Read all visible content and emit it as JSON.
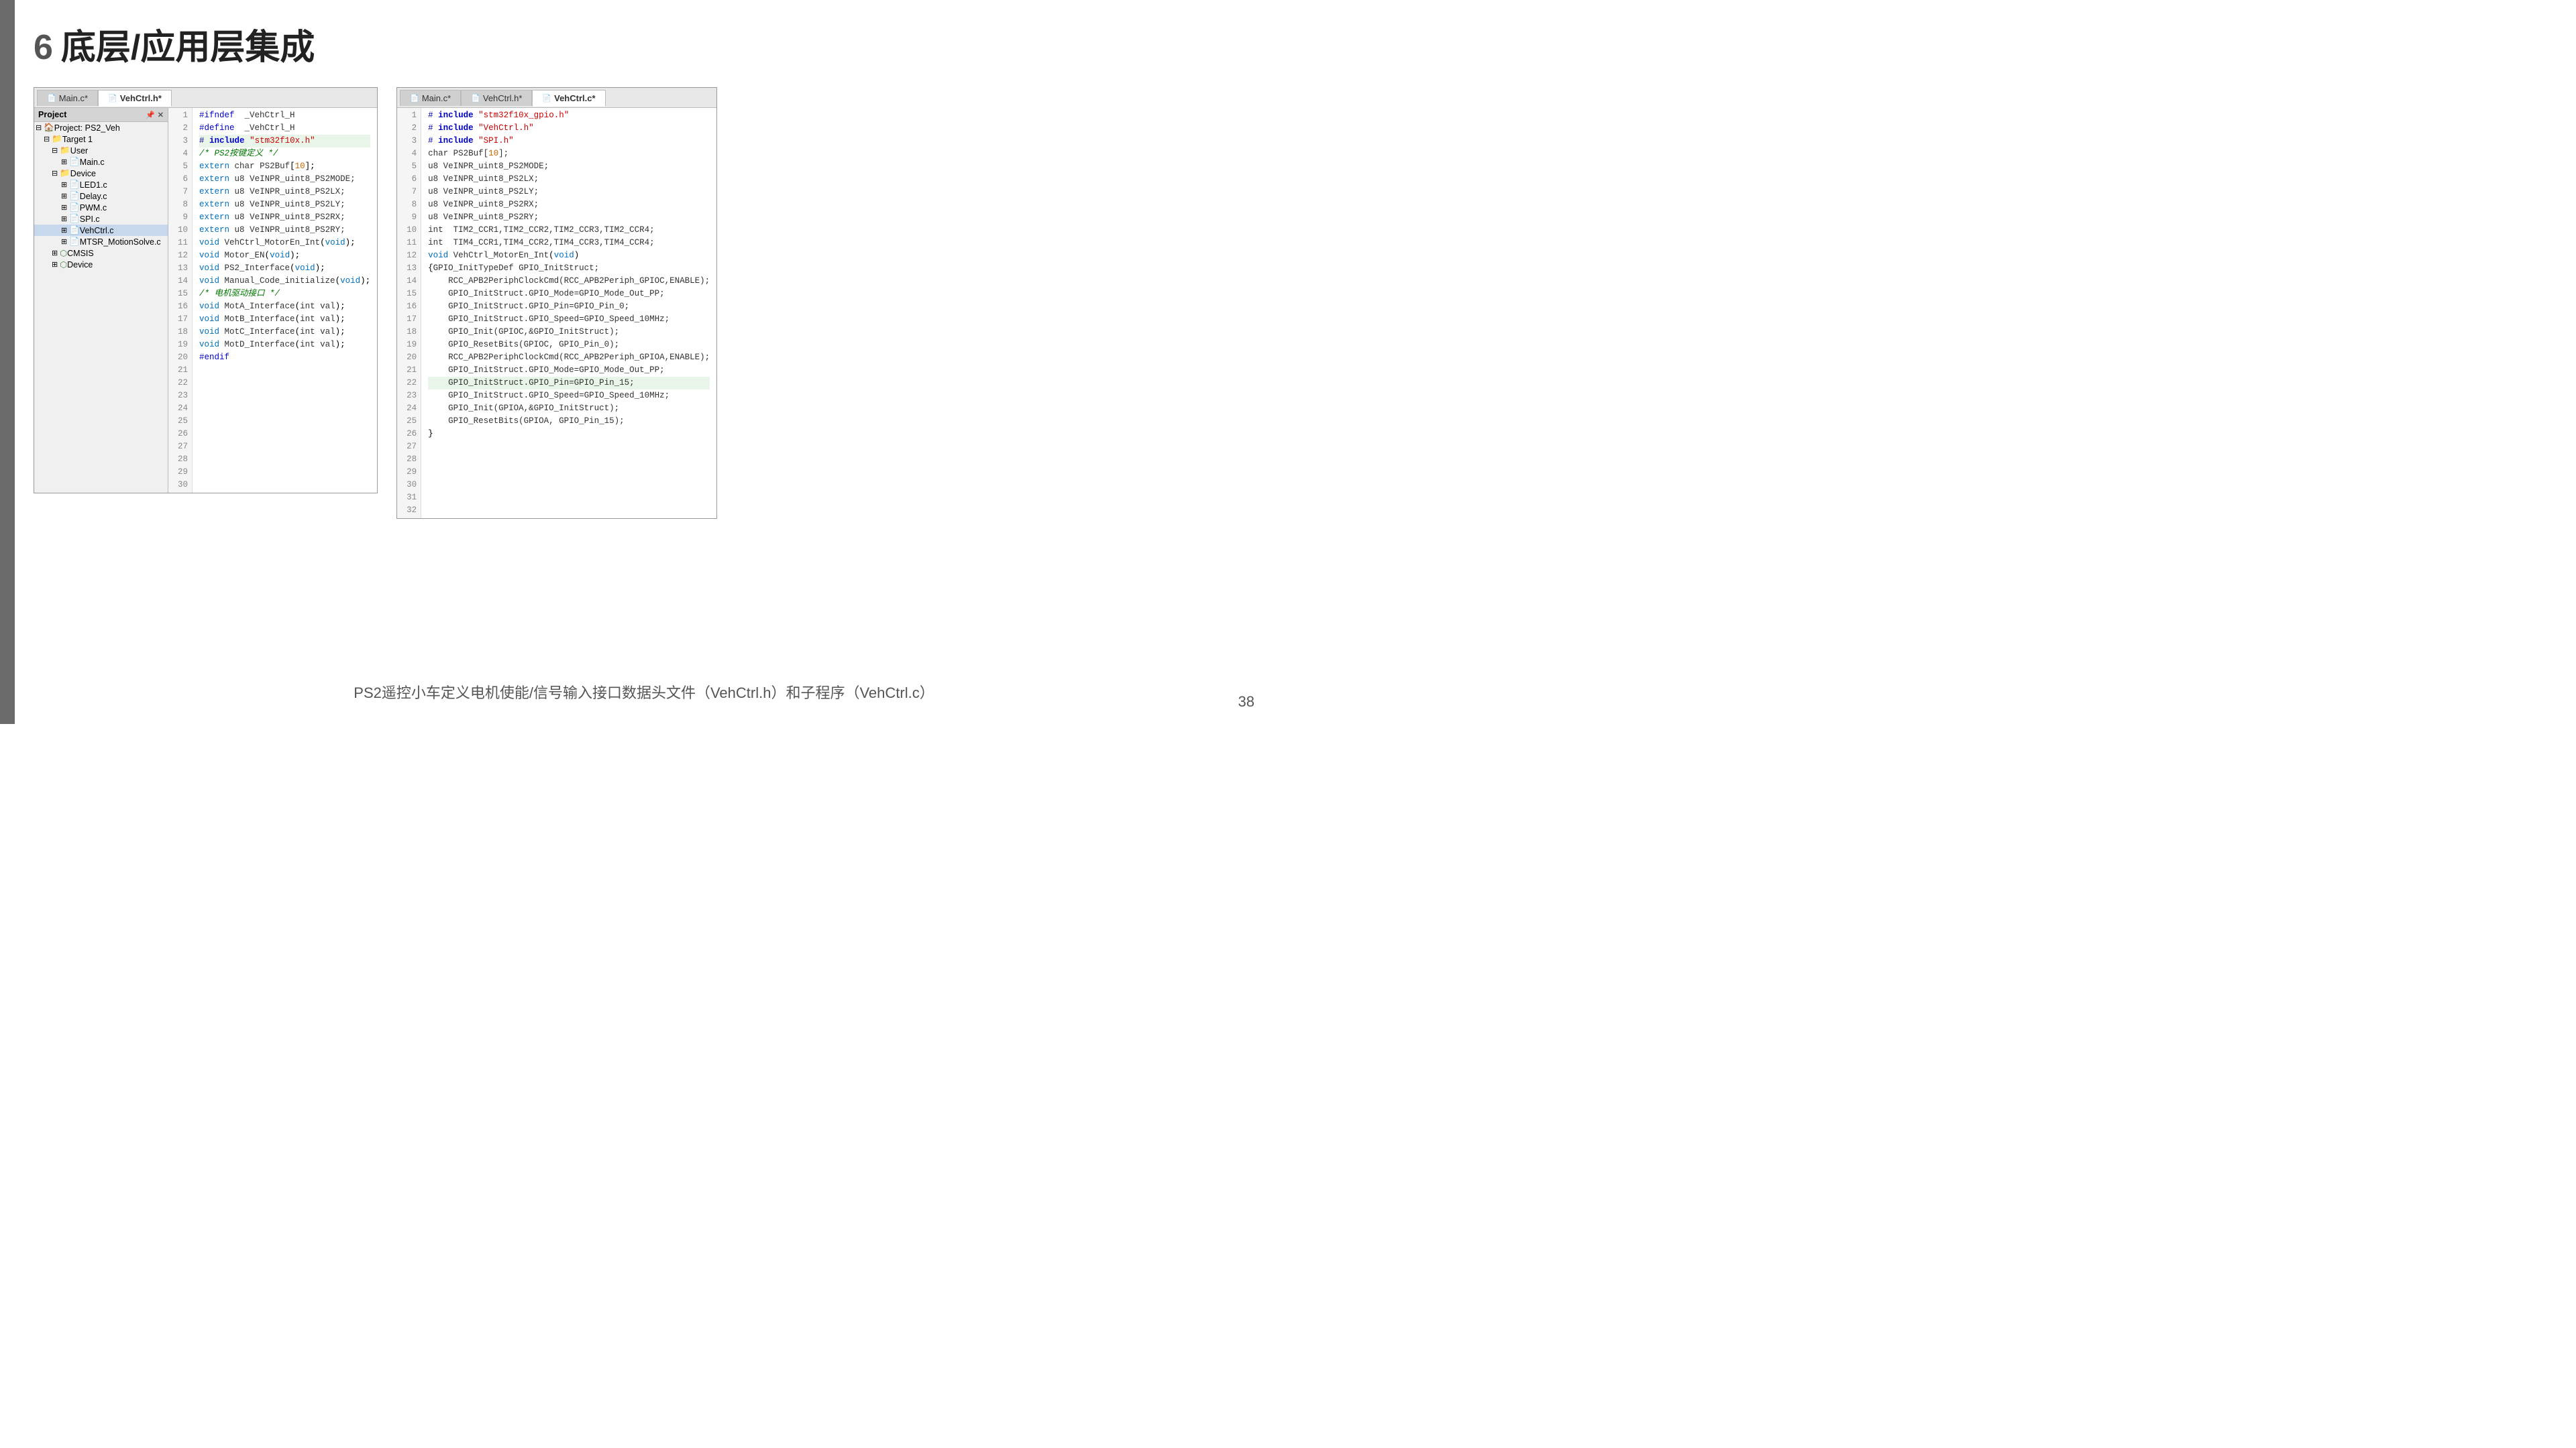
{
  "page": {
    "title_num": "6",
    "title_text": "底层/应用层集成",
    "page_number": "38",
    "caption": "PS2遥控小车定义电机使能/信号输入接口数据头文件（VehCtrl.h）和子程序（VehCtrl.c）"
  },
  "left_ide": {
    "tabs": [
      {
        "label": "Main.c*",
        "active": false,
        "icon": "file"
      },
      {
        "label": "VehCtrl.h*",
        "active": true,
        "icon": "file"
      }
    ],
    "project_tree_title": "Project",
    "tree_items": [
      {
        "indent": 0,
        "type": "tree",
        "label": "Project: PS2_Veh",
        "icon": "tree"
      },
      {
        "indent": 1,
        "type": "tree",
        "label": "Target 1",
        "icon": "tree"
      },
      {
        "indent": 2,
        "type": "folder",
        "label": "User",
        "icon": "folder"
      },
      {
        "indent": 3,
        "type": "file",
        "label": "Main.c",
        "icon": "file"
      },
      {
        "indent": 2,
        "type": "folder",
        "label": "Device",
        "icon": "folder"
      },
      {
        "indent": 3,
        "type": "file",
        "label": "LED1.c",
        "icon": "file"
      },
      {
        "indent": 3,
        "type": "file",
        "label": "Delay.c",
        "icon": "file"
      },
      {
        "indent": 3,
        "type": "file",
        "label": "PWM.c",
        "icon": "file"
      },
      {
        "indent": 3,
        "type": "file",
        "label": "SPI.c",
        "icon": "file"
      },
      {
        "indent": 3,
        "type": "file",
        "label": "VehCtrl.c",
        "icon": "file",
        "selected": true
      },
      {
        "indent": 3,
        "type": "file",
        "label": "MTSR_MotionSolve.c",
        "icon": "file"
      },
      {
        "indent": 2,
        "type": "gear",
        "label": "CMSIS",
        "icon": "gear"
      },
      {
        "indent": 2,
        "type": "gear",
        "label": "Device",
        "icon": "gear"
      }
    ],
    "code_lines": [
      {
        "n": 1,
        "text": "#ifndef  _VehCtrl_H",
        "hl": false
      },
      {
        "n": 2,
        "text": "#define  _VehCtrl_H",
        "hl": false
      },
      {
        "n": 3,
        "text": "",
        "hl": false
      },
      {
        "n": 4,
        "text": "# include \"stm32f10x.h\"",
        "hl": true
      },
      {
        "n": 5,
        "text": "",
        "hl": false
      },
      {
        "n": 6,
        "text": "/* PS2按键定义 */",
        "hl": false
      },
      {
        "n": 7,
        "text": "extern char PS2Buf[10];",
        "hl": false
      },
      {
        "n": 8,
        "text": "",
        "hl": false
      },
      {
        "n": 9,
        "text": "extern u8 VeINPR_uint8_PS2MODE;",
        "hl": false
      },
      {
        "n": 10,
        "text": "extern u8 VeINPR_uint8_PS2LX;",
        "hl": false
      },
      {
        "n": 11,
        "text": "extern u8 VeINPR_uint8_PS2LY;",
        "hl": false
      },
      {
        "n": 12,
        "text": "extern u8 VeINPR_uint8_PS2RX;",
        "hl": false
      },
      {
        "n": 13,
        "text": "extern u8 VeINPR_uint8_PS2RY;",
        "hl": false
      },
      {
        "n": 14,
        "text": "",
        "hl": false
      },
      {
        "n": 15,
        "text": "void VehCtrl_MotorEn_Int(void);",
        "hl": false
      },
      {
        "n": 16,
        "text": "void Motor_EN(void);",
        "hl": false
      },
      {
        "n": 17,
        "text": "",
        "hl": false
      },
      {
        "n": 18,
        "text": "void PS2_Interface(void);",
        "hl": false
      },
      {
        "n": 19,
        "text": "void Manual_Code_initialize(void);",
        "hl": false
      },
      {
        "n": 20,
        "text": "",
        "hl": false
      },
      {
        "n": 21,
        "text": "",
        "hl": false
      },
      {
        "n": 22,
        "text": "/* 电机驱动接口 */",
        "hl": false
      },
      {
        "n": 23,
        "text": "void MotA_Interface(int val);",
        "hl": false
      },
      {
        "n": 24,
        "text": "void MotB_Interface(int val);",
        "hl": false
      },
      {
        "n": 25,
        "text": "void MotC_Interface(int val);",
        "hl": false
      },
      {
        "n": 26,
        "text": "void MotD_Interface(int val);",
        "hl": false
      },
      {
        "n": 27,
        "text": "",
        "hl": false
      },
      {
        "n": 28,
        "text": "#endif",
        "hl": false
      },
      {
        "n": 29,
        "text": "",
        "hl": false
      },
      {
        "n": 30,
        "text": "",
        "hl": false
      }
    ]
  },
  "right_ide": {
    "tabs": [
      {
        "label": "Main.c*",
        "active": false,
        "icon": "file"
      },
      {
        "label": "VehCtrl.h*",
        "active": false,
        "icon": "file"
      },
      {
        "label": "VehCtrl.c*",
        "active": true,
        "icon": "file"
      }
    ],
    "code_lines": [
      {
        "n": 1,
        "text": "# include \"stm32f10x_gpio.h\"",
        "hl": false
      },
      {
        "n": 2,
        "text": "# include \"VehCtrl.h\"",
        "hl": false
      },
      {
        "n": 3,
        "text": "# include \"SPI.h\"",
        "hl": false
      },
      {
        "n": 4,
        "text": "",
        "hl": false
      },
      {
        "n": 5,
        "text": "char PS2Buf[10];",
        "hl": false
      },
      {
        "n": 6,
        "text": "",
        "hl": false
      },
      {
        "n": 7,
        "text": "u8 VeINPR_uint8_PS2MODE;",
        "hl": false
      },
      {
        "n": 8,
        "text": "u8 VeINPR_uint8_PS2LX;",
        "hl": false
      },
      {
        "n": 9,
        "text": "u8 VeINPR_uint8_PS2LY;",
        "hl": false
      },
      {
        "n": 10,
        "text": "u8 VeINPR_uint8_PS2RX;",
        "hl": false
      },
      {
        "n": 11,
        "text": "u8 VeINPR_uint8_PS2RY;",
        "hl": false
      },
      {
        "n": 12,
        "text": "",
        "hl": false
      },
      {
        "n": 13,
        "text": "int  TIM2_CCR1,TIM2_CCR2,TIM2_CCR3,TIM2_CCR4;",
        "hl": false
      },
      {
        "n": 14,
        "text": "int  TIM4_CCR1,TIM4_CCR2,TIM4_CCR3,TIM4_CCR4;",
        "hl": false
      },
      {
        "n": 15,
        "text": "",
        "hl": false
      },
      {
        "n": 16,
        "text": "void VehCtrl_MotorEn_Int(void)",
        "hl": false
      },
      {
        "n": 17,
        "text": "{GPIO_InitTypeDef GPIO_InitStruct;",
        "hl": false
      },
      {
        "n": 18,
        "text": "",
        "hl": false
      },
      {
        "n": 19,
        "text": "    RCC_APB2PeriphClockCmd(RCC_APB2Periph_GPIOC,ENABLE);",
        "hl": false
      },
      {
        "n": 20,
        "text": "    GPIO_InitStruct.GPIO_Mode=GPIO_Mode_Out_PP;",
        "hl": false
      },
      {
        "n": 21,
        "text": "    GPIO_InitStruct.GPIO_Pin=GPIO_Pin_0;",
        "hl": false
      },
      {
        "n": 22,
        "text": "    GPIO_InitStruct.GPIO_Speed=GPIO_Speed_10MHz;",
        "hl": false
      },
      {
        "n": 23,
        "text": "    GPIO_Init(GPIOC,&GPIO_InitStruct);",
        "hl": false
      },
      {
        "n": 24,
        "text": "    GPIO_ResetBits(GPIOC, GPIO_Pin_0);",
        "hl": false
      },
      {
        "n": 25,
        "text": "",
        "hl": false
      },
      {
        "n": 26,
        "text": "    RCC_APB2PeriphClockCmd(RCC_APB2Periph_GPIOA,ENABLE);",
        "hl": false
      },
      {
        "n": 27,
        "text": "    GPIO_InitStruct.GPIO_Mode=GPIO_Mode_Out_PP;",
        "hl": false
      },
      {
        "n": 28,
        "text": "    GPIO_InitStruct.GPIO_Pin=GPIO_Pin_15;",
        "hl": true
      },
      {
        "n": 29,
        "text": "    GPIO_InitStruct.GPIO_Speed=GPIO_Speed_10MHz;",
        "hl": false
      },
      {
        "n": 30,
        "text": "    GPIO_Init(GPIOA,&GPIO_InitStruct);",
        "hl": false
      },
      {
        "n": 31,
        "text": "    GPIO_ResetBits(GPIOA, GPIO_Pin_15);",
        "hl": false
      },
      {
        "n": 32,
        "text": "}",
        "hl": false
      }
    ]
  }
}
